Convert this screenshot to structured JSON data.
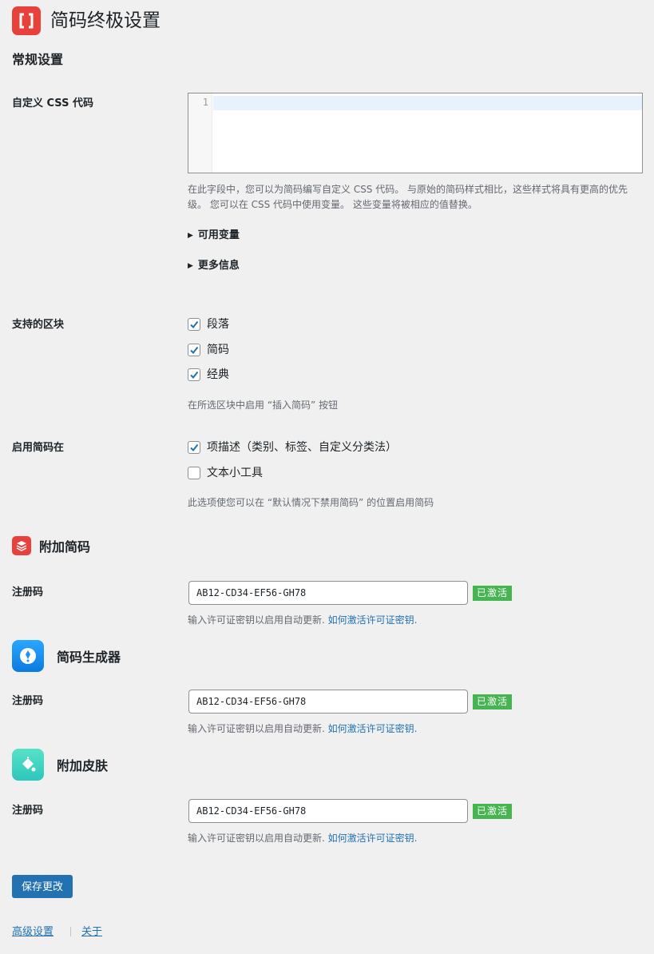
{
  "header": {
    "title": "简码终极设置",
    "logo_icon": "brackets-icon",
    "logo_color": "#e8413b"
  },
  "general": {
    "section_title": "常规设置",
    "custom_css": {
      "label": "自定义 CSS 代码",
      "line_number": "1",
      "description": "在此字段中，您可以为简码编写自定义 CSS 代码。 与原始的简码样式相比，这些样式将具有更高的优先级。 您可以在 CSS 代码中使用变量。 这些变量将被相应的值替换。",
      "available_vars": "可用变量",
      "more_info": "更多信息"
    },
    "supported_blocks": {
      "label": "支持的区块",
      "options": [
        {
          "label": "段落",
          "checked": true
        },
        {
          "label": "简码",
          "checked": true
        },
        {
          "label": "经典",
          "checked": true
        }
      ],
      "description": "在所选区块中启用 “插入简码” 按钮"
    },
    "enable_in": {
      "label": "启用简码在",
      "options": [
        {
          "label": "项描述（类别、标签、自定义分类法）",
          "checked": true
        },
        {
          "label": "文本小工具",
          "checked": false
        }
      ],
      "description": "此选项使您可以在 “默认情况下禁用简码” 的位置启用简码"
    }
  },
  "addons": [
    {
      "title": "附加简码",
      "icon": "layers-icon",
      "color": "#e8413b",
      "license_label": "注册码",
      "license_value": "AB12-CD34-EF56-GH78",
      "status": "已激活",
      "help_text": "输入许可证密钥以启用自动更新.",
      "help_link": "如何激活许可证密钥."
    },
    {
      "title": "简码生成器",
      "icon": "generator-icon",
      "color": "#1e90ff",
      "license_label": "注册码",
      "license_value": "AB12-CD34-EF56-GH78",
      "status": "已激活",
      "help_text": "输入许可证密钥以启用自动更新.",
      "help_link": "如何激活许可证密钥."
    },
    {
      "title": "附加皮肤",
      "icon": "paint-bucket-icon",
      "color": "#3ad6c0",
      "license_label": "注册码",
      "license_value": "AB12-CD34-EF56-GH78",
      "status": "已激活",
      "help_text": "输入许可证密钥以启用自动更新.",
      "help_link": "如何激活许可证密钥."
    }
  ],
  "save_label": "保存更改",
  "footer": {
    "advanced": "高级设置",
    "about": "关于"
  },
  "colors": {
    "accent": "#2271b1",
    "badge": "#46b450"
  }
}
